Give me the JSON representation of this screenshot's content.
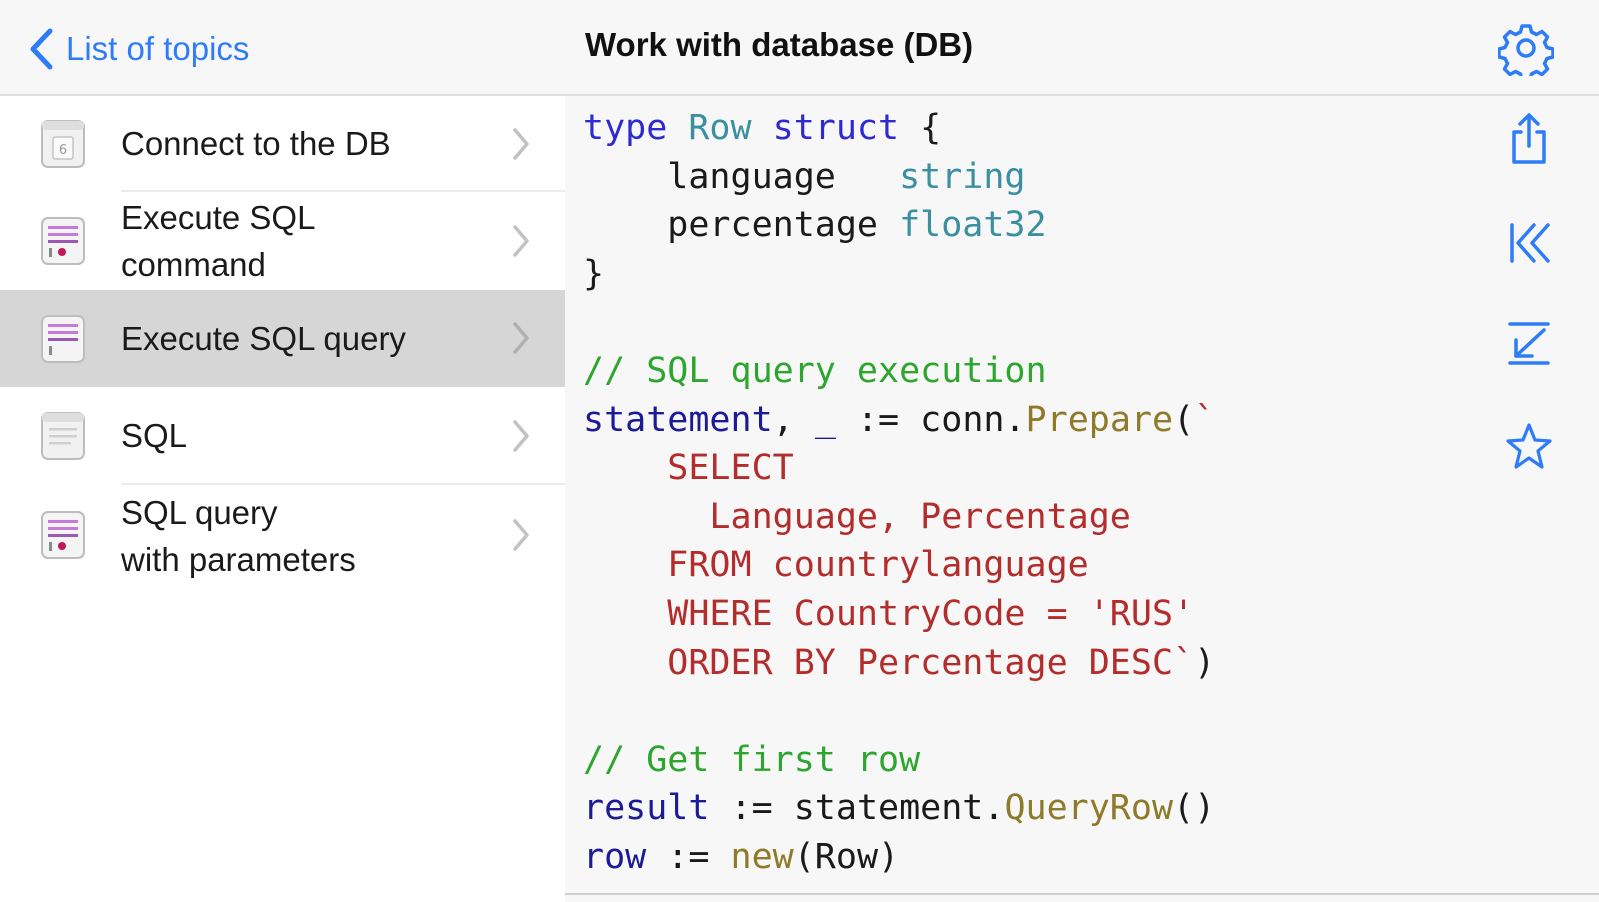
{
  "header": {
    "back_label": "List of topics",
    "title": "Work with database (DB)"
  },
  "sidebar": {
    "items": [
      {
        "label_line1": "Connect to the DB",
        "label_line2": "",
        "icon": "numbered-page-icon",
        "selected": false
      },
      {
        "label_line1": "Execute SQL",
        "label_line2": "command",
        "icon": "code-file-icon",
        "selected": false
      },
      {
        "label_line1": "Execute SQL query",
        "label_line2": "",
        "icon": "code-file-icon",
        "selected": true
      },
      {
        "label_line1": "SQL",
        "label_line2": "",
        "icon": "text-page-icon",
        "selected": false
      },
      {
        "label_line1": "SQL query",
        "label_line2": "with parameters",
        "icon": "code-file-icon",
        "selected": false
      }
    ]
  },
  "code": {
    "language": "Go",
    "lines": [
      "type Row struct {",
      "    language   string",
      "    percentage float32",
      "}",
      "",
      "// SQL query execution",
      "statement, _ := conn.Prepare(`",
      "    SELECT",
      "      Language, Percentage",
      "    FROM countrylanguage",
      "    WHERE CountryCode = 'RUS'",
      "    ORDER BY Percentage DESC`)",
      "",
      "// Get first row",
      "result := statement.QueryRow()",
      "row := new(Row)"
    ]
  },
  "toolbar": {
    "icons": [
      "settings-gear-icon",
      "share-icon",
      "go-to-start-icon",
      "scroll-to-end-icon",
      "favorite-star-icon"
    ]
  },
  "colors": {
    "accent": "#2e7cf6",
    "keyword": "#2f2ad0",
    "type": "#3a8fa0",
    "comment": "#2ea52e",
    "string": "#b32d2d",
    "function": "#8f7a2a",
    "selected_row": "#d6d6d6"
  }
}
